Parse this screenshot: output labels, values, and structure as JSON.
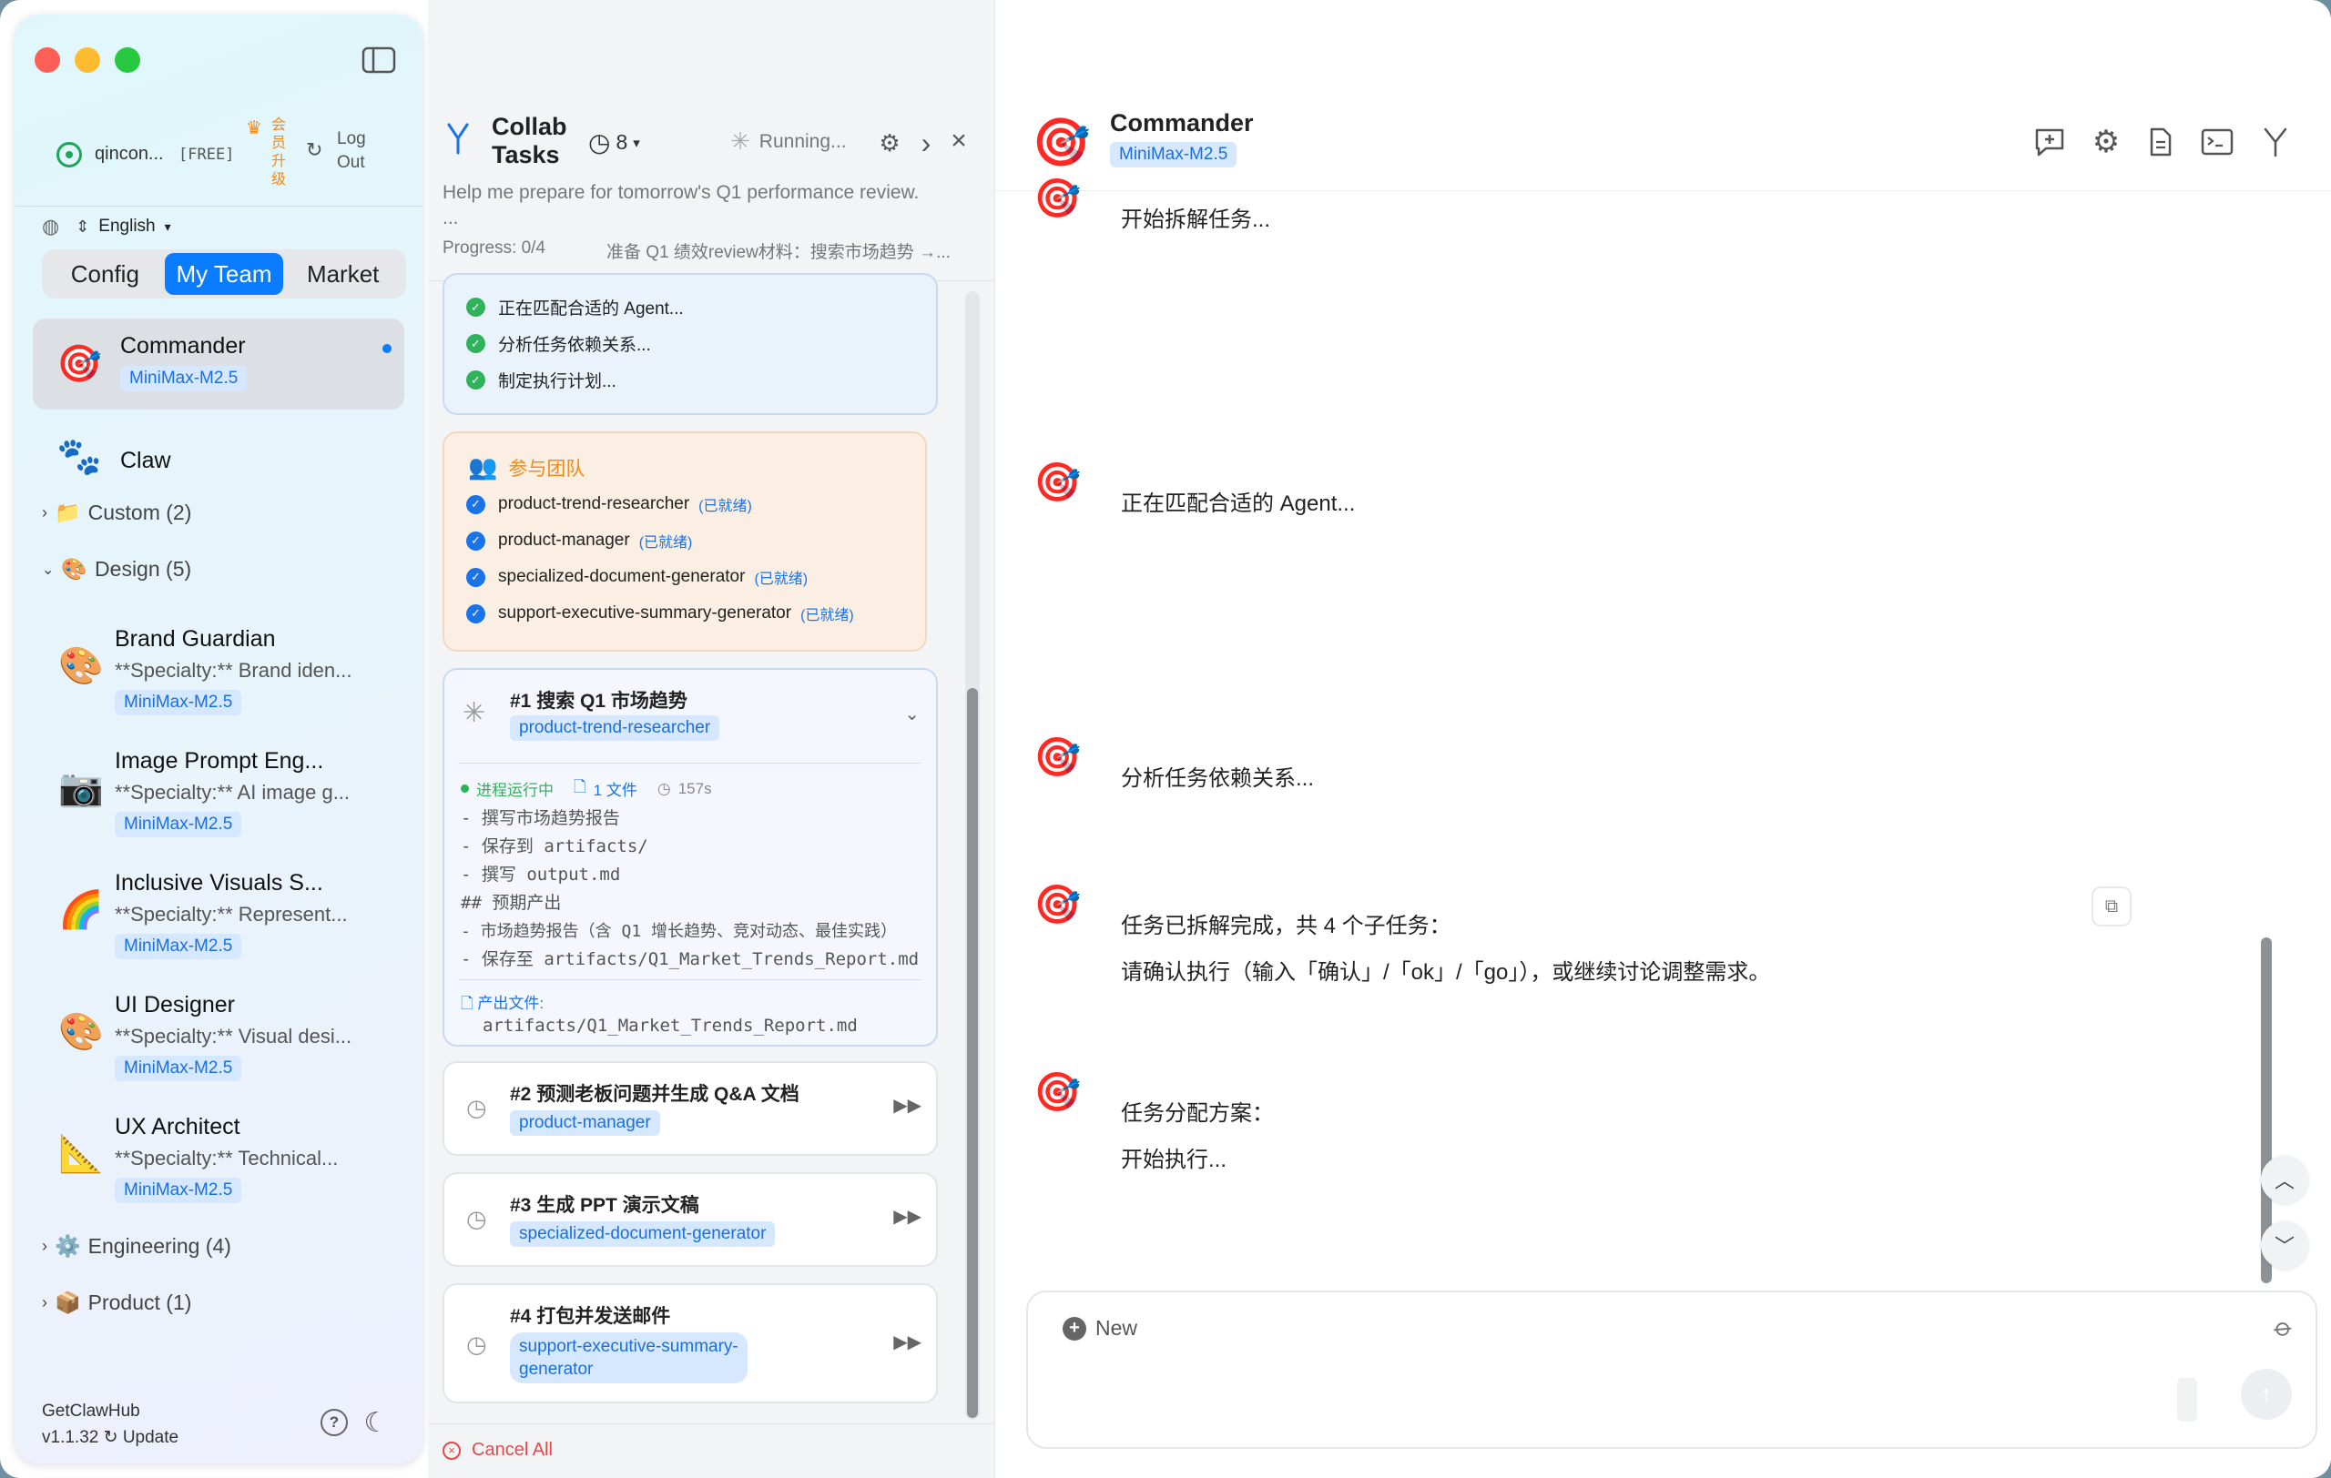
{
  "sidebar": {
    "user": {
      "name": "qincon...",
      "plan": "[FREE]",
      "upgrade": "会员升级",
      "logout": "Log Out"
    },
    "language": "English",
    "tabs": [
      "Config",
      "My Team",
      "Market"
    ],
    "active_tab": "My Team",
    "agents_top": [
      {
        "emoji": "🎯",
        "name": "Commander",
        "model": "MiniMax-M2.5",
        "selected": true
      },
      {
        "emoji": "🐾",
        "name": "Claw"
      }
    ],
    "groups": {
      "custom": {
        "icon": "📁",
        "label": "Custom (2)"
      },
      "design": {
        "icon": "🎨",
        "label": "Design (5)"
      },
      "engineering": {
        "icon": "⚙️",
        "label": "Engineering (4)"
      },
      "product": {
        "icon": "📦",
        "label": "Product (1)"
      }
    },
    "design_agents": [
      {
        "emoji": "🎨",
        "name": "Brand Guardian",
        "specialty": "**Specialty:** Brand iden...",
        "model": "MiniMax-M2.5"
      },
      {
        "emoji": "📷",
        "name": "Image Prompt Eng...",
        "specialty": "**Specialty:** AI image g...",
        "model": "MiniMax-M2.5"
      },
      {
        "emoji": "🌈",
        "name": "Inclusive Visuals S...",
        "specialty": "**Specialty:** Represent...",
        "model": "MiniMax-M2.5"
      },
      {
        "emoji": "🎨",
        "name": "UI Designer",
        "specialty": "**Specialty:** Visual desi...",
        "model": "MiniMax-M2.5"
      },
      {
        "emoji": "📐",
        "name": "UX Architect",
        "specialty": "**Specialty:** Technical...",
        "model": "MiniMax-M2.5"
      }
    ],
    "footer": {
      "brand": "GetClawHub",
      "version": "v1.1.32",
      "update": "Update"
    }
  },
  "collab": {
    "title_line1": "Collab",
    "title_line2": "Tasks",
    "history_count": "8",
    "status": "Running...",
    "prompt": "Help me prepare for tomorrow's Q1 performance review.",
    "ellipsis": "...",
    "progress": "Progress: 0/4",
    "progress_desc": "准备 Q1 绩效review材料：搜索市场趋势 →...",
    "plan_steps": [
      "正在匹配合适的 Agent...",
      "分析任务依赖关系...",
      "制定执行计划..."
    ],
    "team_title": "参与团队",
    "ready_label": "(已就绪)",
    "team": [
      "product-trend-researcher",
      "product-manager",
      "specialized-document-generator",
      "support-executive-summary-generator"
    ],
    "task1": {
      "title": "#1 搜索 Q1 市场趋势",
      "agent": "product-trend-researcher",
      "running": "进程运行中",
      "files": "1 文件",
      "time": "157s",
      "log": [
        "- 撰写市场趋势报告",
        "- 保存到 artifacts/",
        "- 撰写 output.md",
        "## 预期产出",
        "- 市场趋势报告（含 Q1 增长趋势、竞对动态、最佳实践）",
        "- 保存至 artifacts/Q1_Market_Trends_Report.md"
      ],
      "output_label": "产出文件:",
      "output_file": "artifacts/Q1_Market_Trends_Report.md"
    },
    "task2": {
      "title": "#2 预测老板问题并生成 Q&A 文档",
      "agent": "product-manager"
    },
    "task3": {
      "title": "#3 生成 PPT 演示文稿",
      "agent": "specialized-document-generator"
    },
    "task4": {
      "title": "#4 打包并发送邮件",
      "agent_l1": "support-executive-summary-",
      "agent_l2": "generator"
    },
    "cancel_all": "Cancel All"
  },
  "chat": {
    "agent_name": "Commander",
    "model": "MiniMax-M2.5",
    "messages": [
      {
        "lines": [
          "开始拆解任务..."
        ]
      },
      {
        "lines": [
          "正在匹配合适的 Agent..."
        ]
      },
      {
        "lines": [
          "分析任务依赖关系..."
        ]
      },
      {
        "lines": [
          "任务已拆解完成，共 4 个子任务：",
          "请确认执行（输入「确认」/「ok」/「go」），或继续讨论调整需求。"
        ]
      },
      {
        "lines": [
          "任务分配方案：",
          "开始执行..."
        ]
      }
    ],
    "input": {
      "new_label": "New"
    }
  },
  "colors": {
    "accent": "#0a7cff",
    "success": "#2fb35a",
    "warning": "#f08a1c",
    "danger": "#e5484d"
  }
}
